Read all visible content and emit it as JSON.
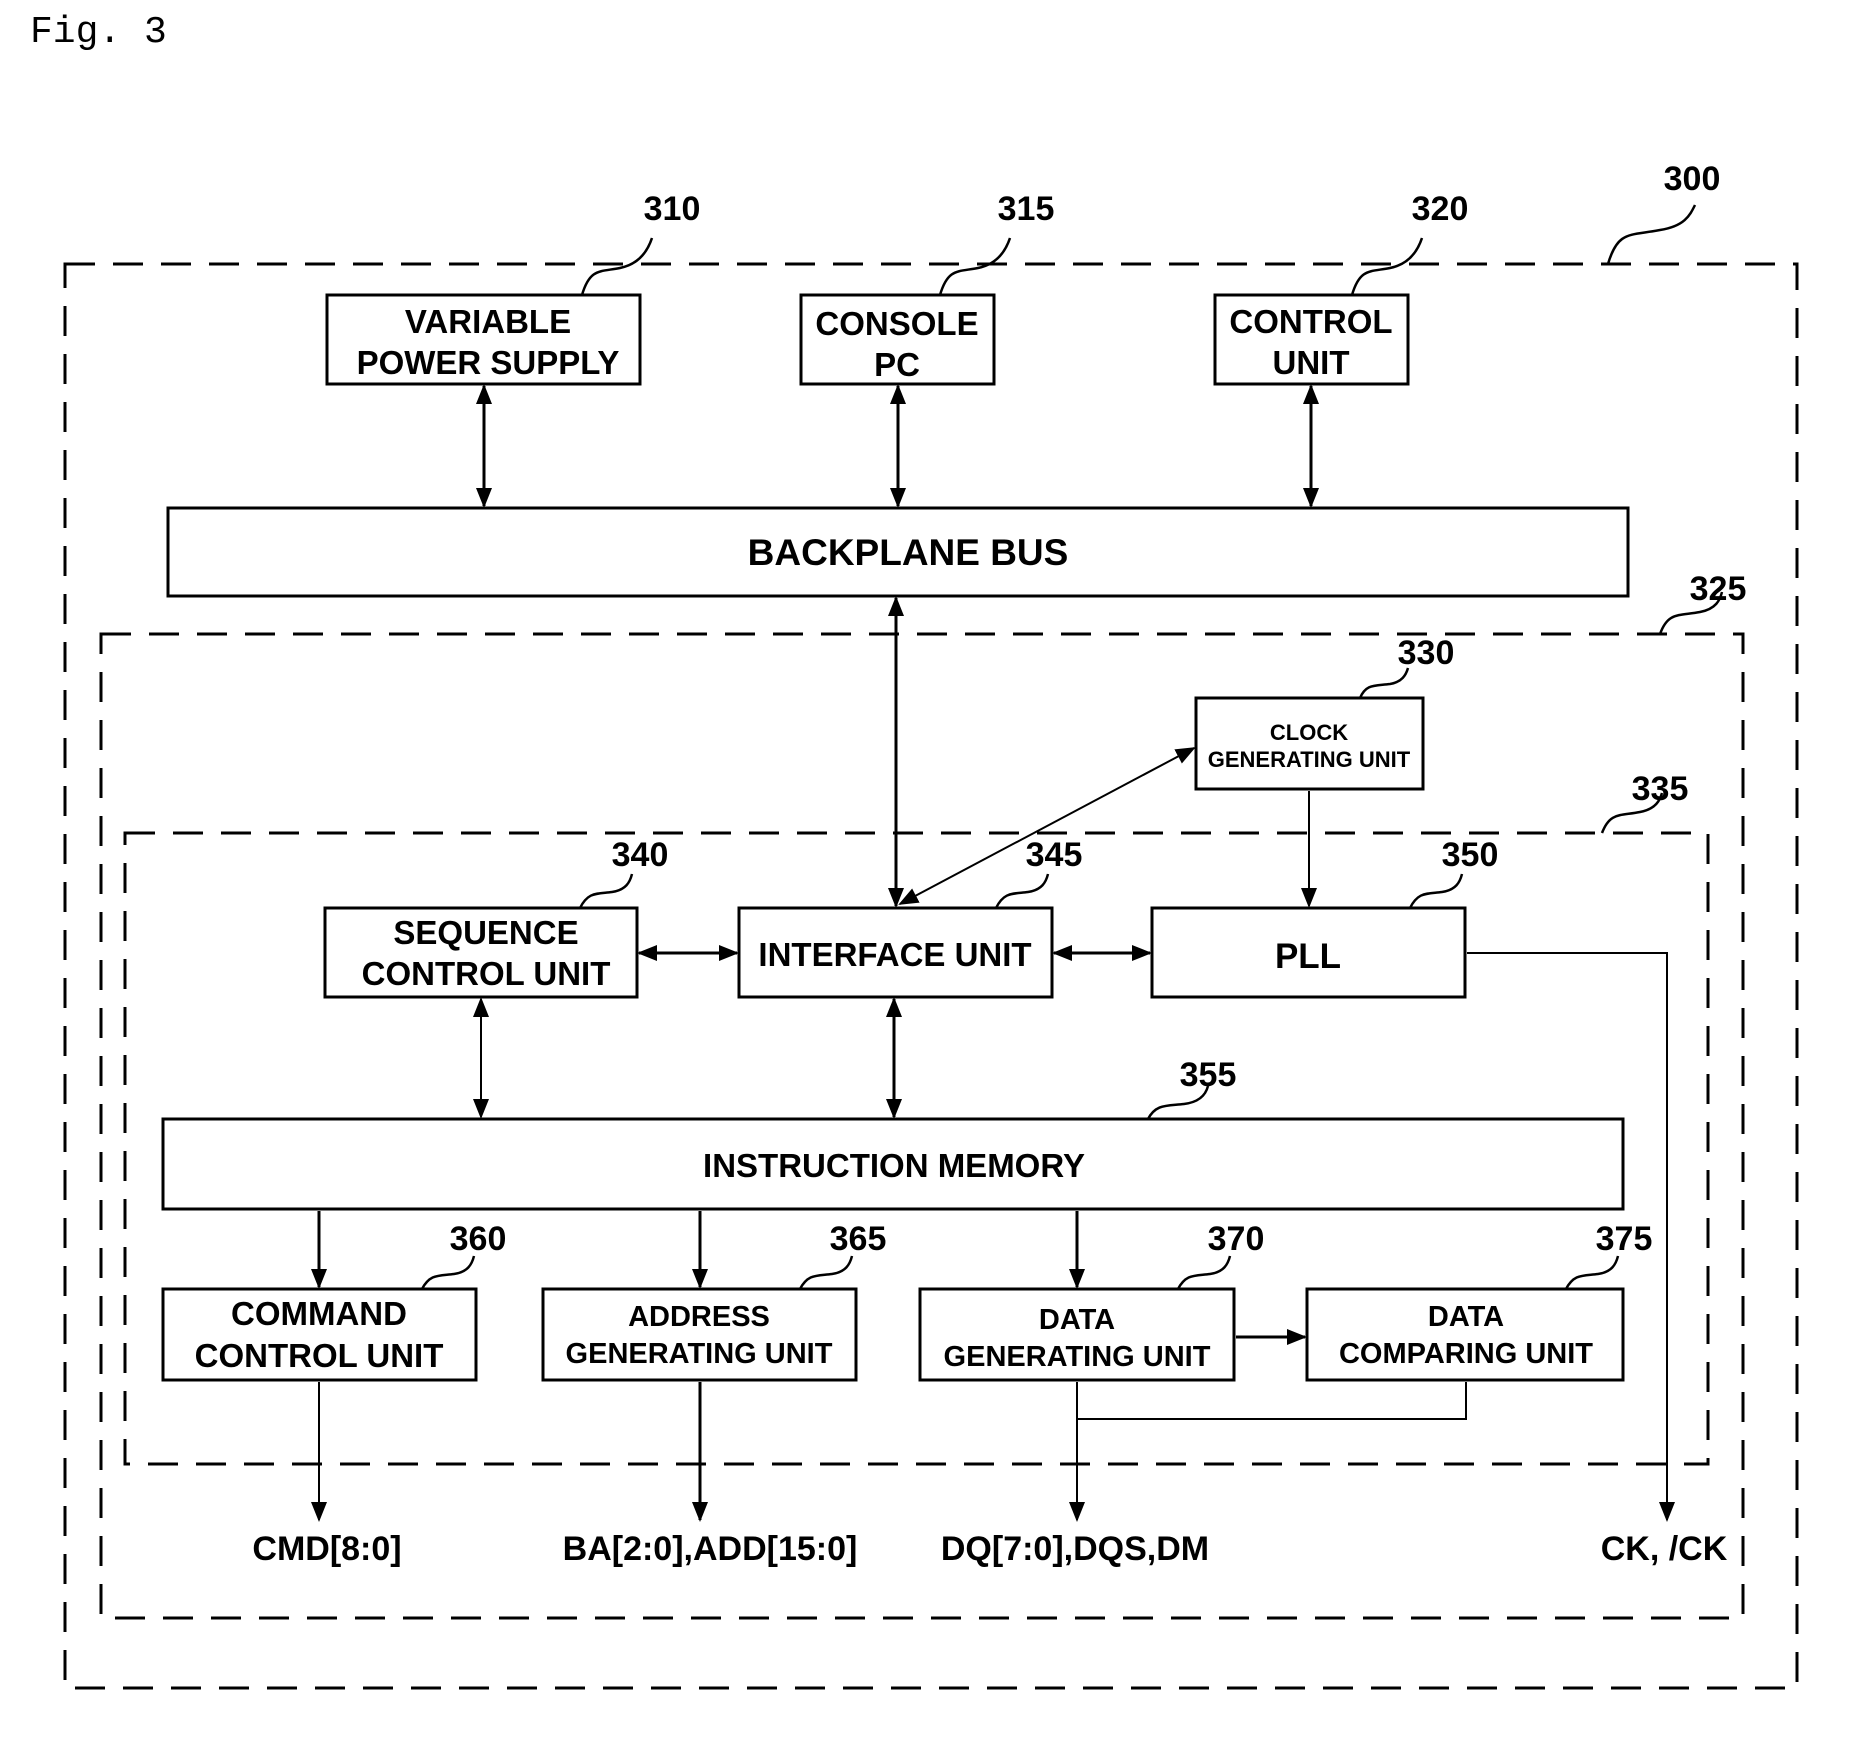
{
  "figure": {
    "title": "Fig. 3"
  },
  "boundaries": [
    {
      "ref": "300",
      "description": "test apparatus boundary"
    },
    {
      "ref": "325",
      "description": "inner module boundary"
    },
    {
      "ref": "335",
      "description": "controller boundary"
    }
  ],
  "blocks": {
    "variable_power_supply": {
      "ref": "310",
      "lines": [
        "VARIABLE",
        "POWER SUPPLY"
      ]
    },
    "console_pc": {
      "ref": "315",
      "lines": [
        "CONSOLE",
        "PC"
      ]
    },
    "control_unit": {
      "ref": "320",
      "lines": [
        "CONTROL",
        "UNIT"
      ]
    },
    "backplane_bus": {
      "lines": [
        "BACKPLANE BUS"
      ]
    },
    "clock_generating_unit": {
      "ref": "330",
      "lines": [
        "CLOCK",
        "GENERATING UNIT"
      ]
    },
    "sequence_control_unit": {
      "ref": "340",
      "lines": [
        "SEQUENCE",
        "CONTROL UNIT"
      ]
    },
    "interface_unit": {
      "ref": "345",
      "lines": [
        "INTERFACE UNIT"
      ]
    },
    "pll": {
      "ref": "350",
      "lines": [
        "PLL"
      ]
    },
    "instruction_memory": {
      "ref": "355",
      "lines": [
        "INSTRUCTION MEMORY"
      ]
    },
    "command_control_unit": {
      "ref": "360",
      "lines": [
        "COMMAND",
        "CONTROL UNIT"
      ]
    },
    "address_generating_unit": {
      "ref": "365",
      "lines": [
        "ADDRESS",
        "GENERATING UNIT"
      ]
    },
    "data_generating_unit": {
      "ref": "370",
      "lines": [
        "DATA",
        "GENERATING UNIT"
      ]
    },
    "data_comparing_unit": {
      "ref": "375",
      "lines": [
        "DATA",
        "COMPARING UNIT"
      ]
    }
  },
  "outputs": {
    "cmd": "CMD[8:0]",
    "address": "BA[2:0],ADD[15:0]",
    "data": "DQ[7:0],DQS,DM",
    "clock": "CK, /CK"
  },
  "connections": [
    {
      "from": "variable_power_supply",
      "to": "backplane_bus",
      "direction": "bidirectional"
    },
    {
      "from": "console_pc",
      "to": "backplane_bus",
      "direction": "bidirectional"
    },
    {
      "from": "control_unit",
      "to": "backplane_bus",
      "direction": "bidirectional"
    },
    {
      "from": "backplane_bus",
      "to": "interface_unit",
      "direction": "bidirectional"
    },
    {
      "from": "interface_unit",
      "to": "clock_generating_unit",
      "direction": "bidirectional"
    },
    {
      "from": "clock_generating_unit",
      "to": "pll",
      "direction": "forward"
    },
    {
      "from": "sequence_control_unit",
      "to": "interface_unit",
      "direction": "bidirectional"
    },
    {
      "from": "interface_unit",
      "to": "pll",
      "direction": "bidirectional"
    },
    {
      "from": "sequence_control_unit",
      "to": "instruction_memory",
      "direction": "bidirectional"
    },
    {
      "from": "interface_unit",
      "to": "instruction_memory",
      "direction": "bidirectional"
    },
    {
      "from": "instruction_memory",
      "to": "command_control_unit",
      "direction": "forward"
    },
    {
      "from": "instruction_memory",
      "to": "address_generating_unit",
      "direction": "forward"
    },
    {
      "from": "instruction_memory",
      "to": "data_generating_unit",
      "direction": "forward"
    },
    {
      "from": "data_generating_unit",
      "to": "data_comparing_unit",
      "direction": "forward"
    },
    {
      "from": "command_control_unit",
      "to": "cmd",
      "direction": "forward"
    },
    {
      "from": "address_generating_unit",
      "to": "address",
      "direction": "forward"
    },
    {
      "from": "data_generating_unit",
      "to": "data",
      "direction": "forward"
    },
    {
      "from": "data_comparing_unit",
      "to": "data",
      "direction": "forward"
    },
    {
      "from": "pll",
      "to": "clock",
      "direction": "forward"
    }
  ]
}
